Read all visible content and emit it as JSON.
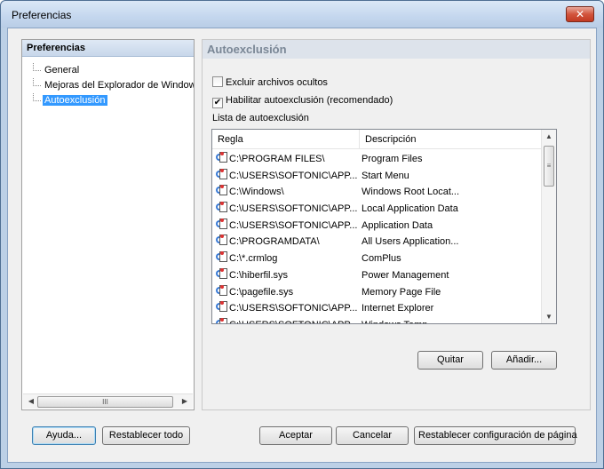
{
  "window": {
    "title": "Preferencias",
    "close_glyph": "✕"
  },
  "left_panel": {
    "header": "Preferencias",
    "items": [
      {
        "label": "General",
        "selected": false
      },
      {
        "label": "Mejoras del Explorador de Windows",
        "selected": false
      },
      {
        "label": "Autoexclusión",
        "selected": true
      }
    ],
    "scroll_thumb_glyph": "III"
  },
  "right_panel": {
    "header": "Autoexclusión",
    "checkboxes": [
      {
        "label": "Excluir archivos ocultos",
        "checked": false
      },
      {
        "label": "Habilitar autoexclusión (recomendado)",
        "checked": true
      }
    ],
    "list_caption": "Lista de autoexclusión",
    "list": {
      "columns": [
        "Regla",
        "Descripción"
      ],
      "rows": [
        {
          "rule": "C:\\PROGRAM FILES\\",
          "description": "Program Files"
        },
        {
          "rule": "C:\\USERS\\SOFTONIC\\APP...",
          "description": "Start Menu"
        },
        {
          "rule": "C:\\Windows\\",
          "description": "Windows Root Locat..."
        },
        {
          "rule": "C:\\USERS\\SOFTONIC\\APP...",
          "description": "Local Application Data"
        },
        {
          "rule": "C:\\USERS\\SOFTONIC\\APP...",
          "description": "Application Data"
        },
        {
          "rule": "C:\\PROGRAMDATA\\",
          "description": "All Users Application..."
        },
        {
          "rule": "C:\\*.crmlog",
          "description": "ComPlus"
        },
        {
          "rule": "C:\\hiberfil.sys",
          "description": "Power Management"
        },
        {
          "rule": "C:\\pagefile.sys",
          "description": "Memory Page File"
        },
        {
          "rule": "C:\\USERS\\SOFTONIC\\APP...",
          "description": "Internet Explorer"
        },
        {
          "rule": "C:\\USERS\\SOFTONIC\\APP...",
          "description": "Windows Temp"
        }
      ]
    },
    "buttons": {
      "remove": "Quitar",
      "add": "Añadir..."
    }
  },
  "footer": {
    "help": "Ayuda...",
    "reset_all": "Restablecer todo",
    "accept": "Aceptar",
    "cancel": "Cancelar",
    "reset_page": "Restablecer configuración de página"
  },
  "icons": {
    "close": "close-icon",
    "scroll_left": "◀",
    "scroll_right": "▶",
    "scroll_up": "▲",
    "scroll_down": "▼",
    "check": "✔",
    "vthumb_glyph": "≡"
  },
  "colors": {
    "selection": "#3399ff",
    "header_text": "#7a8796",
    "close_button": "#c23a22"
  }
}
